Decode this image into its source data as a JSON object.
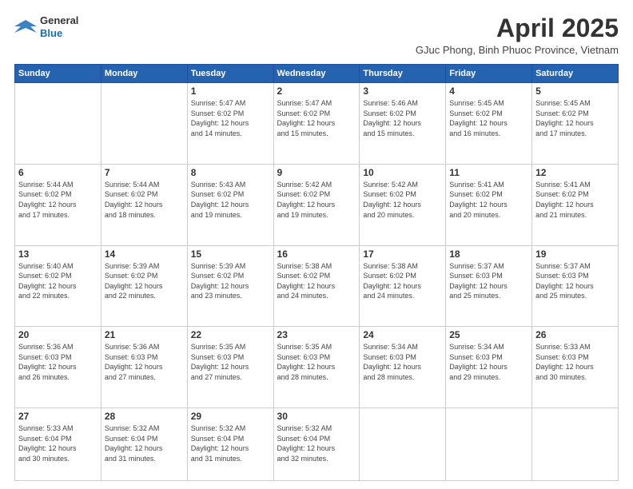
{
  "header": {
    "logo_line1": "General",
    "logo_line2": "Blue",
    "month_year": "April 2025",
    "location": "GJuc Phong, Binh Phuoc Province, Vietnam"
  },
  "weekdays": [
    "Sunday",
    "Monday",
    "Tuesday",
    "Wednesday",
    "Thursday",
    "Friday",
    "Saturday"
  ],
  "weeks": [
    [
      {
        "day": "",
        "info": ""
      },
      {
        "day": "",
        "info": ""
      },
      {
        "day": "1",
        "info": "Sunrise: 5:47 AM\nSunset: 6:02 PM\nDaylight: 12 hours\nand 14 minutes."
      },
      {
        "day": "2",
        "info": "Sunrise: 5:47 AM\nSunset: 6:02 PM\nDaylight: 12 hours\nand 15 minutes."
      },
      {
        "day": "3",
        "info": "Sunrise: 5:46 AM\nSunset: 6:02 PM\nDaylight: 12 hours\nand 15 minutes."
      },
      {
        "day": "4",
        "info": "Sunrise: 5:45 AM\nSunset: 6:02 PM\nDaylight: 12 hours\nand 16 minutes."
      },
      {
        "day": "5",
        "info": "Sunrise: 5:45 AM\nSunset: 6:02 PM\nDaylight: 12 hours\nand 17 minutes."
      }
    ],
    [
      {
        "day": "6",
        "info": "Sunrise: 5:44 AM\nSunset: 6:02 PM\nDaylight: 12 hours\nand 17 minutes."
      },
      {
        "day": "7",
        "info": "Sunrise: 5:44 AM\nSunset: 6:02 PM\nDaylight: 12 hours\nand 18 minutes."
      },
      {
        "day": "8",
        "info": "Sunrise: 5:43 AM\nSunset: 6:02 PM\nDaylight: 12 hours\nand 19 minutes."
      },
      {
        "day": "9",
        "info": "Sunrise: 5:42 AM\nSunset: 6:02 PM\nDaylight: 12 hours\nand 19 minutes."
      },
      {
        "day": "10",
        "info": "Sunrise: 5:42 AM\nSunset: 6:02 PM\nDaylight: 12 hours\nand 20 minutes."
      },
      {
        "day": "11",
        "info": "Sunrise: 5:41 AM\nSunset: 6:02 PM\nDaylight: 12 hours\nand 20 minutes."
      },
      {
        "day": "12",
        "info": "Sunrise: 5:41 AM\nSunset: 6:02 PM\nDaylight: 12 hours\nand 21 minutes."
      }
    ],
    [
      {
        "day": "13",
        "info": "Sunrise: 5:40 AM\nSunset: 6:02 PM\nDaylight: 12 hours\nand 22 minutes."
      },
      {
        "day": "14",
        "info": "Sunrise: 5:39 AM\nSunset: 6:02 PM\nDaylight: 12 hours\nand 22 minutes."
      },
      {
        "day": "15",
        "info": "Sunrise: 5:39 AM\nSunset: 6:02 PM\nDaylight: 12 hours\nand 23 minutes."
      },
      {
        "day": "16",
        "info": "Sunrise: 5:38 AM\nSunset: 6:02 PM\nDaylight: 12 hours\nand 24 minutes."
      },
      {
        "day": "17",
        "info": "Sunrise: 5:38 AM\nSunset: 6:02 PM\nDaylight: 12 hours\nand 24 minutes."
      },
      {
        "day": "18",
        "info": "Sunrise: 5:37 AM\nSunset: 6:03 PM\nDaylight: 12 hours\nand 25 minutes."
      },
      {
        "day": "19",
        "info": "Sunrise: 5:37 AM\nSunset: 6:03 PM\nDaylight: 12 hours\nand 25 minutes."
      }
    ],
    [
      {
        "day": "20",
        "info": "Sunrise: 5:36 AM\nSunset: 6:03 PM\nDaylight: 12 hours\nand 26 minutes."
      },
      {
        "day": "21",
        "info": "Sunrise: 5:36 AM\nSunset: 6:03 PM\nDaylight: 12 hours\nand 27 minutes."
      },
      {
        "day": "22",
        "info": "Sunrise: 5:35 AM\nSunset: 6:03 PM\nDaylight: 12 hours\nand 27 minutes."
      },
      {
        "day": "23",
        "info": "Sunrise: 5:35 AM\nSunset: 6:03 PM\nDaylight: 12 hours\nand 28 minutes."
      },
      {
        "day": "24",
        "info": "Sunrise: 5:34 AM\nSunset: 6:03 PM\nDaylight: 12 hours\nand 28 minutes."
      },
      {
        "day": "25",
        "info": "Sunrise: 5:34 AM\nSunset: 6:03 PM\nDaylight: 12 hours\nand 29 minutes."
      },
      {
        "day": "26",
        "info": "Sunrise: 5:33 AM\nSunset: 6:03 PM\nDaylight: 12 hours\nand 30 minutes."
      }
    ],
    [
      {
        "day": "27",
        "info": "Sunrise: 5:33 AM\nSunset: 6:04 PM\nDaylight: 12 hours\nand 30 minutes."
      },
      {
        "day": "28",
        "info": "Sunrise: 5:32 AM\nSunset: 6:04 PM\nDaylight: 12 hours\nand 31 minutes."
      },
      {
        "day": "29",
        "info": "Sunrise: 5:32 AM\nSunset: 6:04 PM\nDaylight: 12 hours\nand 31 minutes."
      },
      {
        "day": "30",
        "info": "Sunrise: 5:32 AM\nSunset: 6:04 PM\nDaylight: 12 hours\nand 32 minutes."
      },
      {
        "day": "",
        "info": ""
      },
      {
        "day": "",
        "info": ""
      },
      {
        "day": "",
        "info": ""
      }
    ]
  ]
}
